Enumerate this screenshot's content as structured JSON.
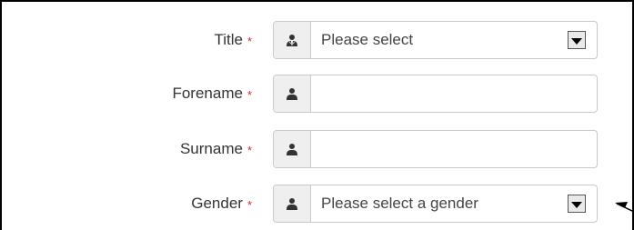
{
  "form": {
    "required_marker": "*",
    "fields": [
      {
        "label": "Title",
        "icon": "user-tie-icon",
        "type": "select",
        "value": "Please select"
      },
      {
        "label": "Forename",
        "icon": "user-icon",
        "type": "text",
        "value": ""
      },
      {
        "label": "Surname",
        "icon": "user-icon",
        "type": "text",
        "value": ""
      },
      {
        "label": "Gender",
        "icon": "user-icon",
        "type": "select",
        "value": "Please select a gender"
      }
    ]
  },
  "colors": {
    "required": "#e0242b",
    "border": "#c9c9c9",
    "addon_bg": "#efefef"
  }
}
